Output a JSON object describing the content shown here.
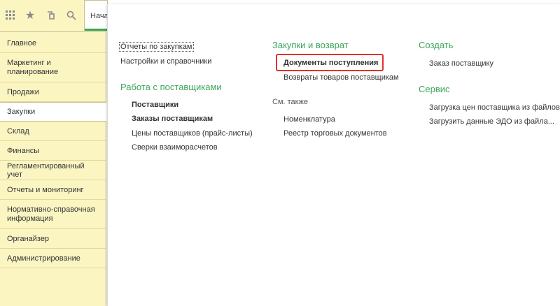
{
  "top_tab": {
    "label": "Нача"
  },
  "sidebar": {
    "items": [
      {
        "label": "Главное"
      },
      {
        "label": "Маркетинг и планирование"
      },
      {
        "label": "Продажи"
      },
      {
        "label": "Закупки"
      },
      {
        "label": "Склад"
      },
      {
        "label": "Финансы"
      },
      {
        "label": "Регламентированный учет"
      },
      {
        "label": "Отчеты и мониторинг"
      },
      {
        "label": "Нормативно-справочная информация"
      },
      {
        "label": "Органайзер"
      },
      {
        "label": "Администрирование"
      }
    ]
  },
  "icons": {
    "apps": "apps-grid-icon",
    "favorites": "star-icon",
    "history": "history-icon",
    "search": "search-icon"
  },
  "col1": {
    "links_top": [
      "Отчеты по закупкам",
      "Настройки и справочники"
    ],
    "section_title": "Работа с поставщиками",
    "links": [
      "Поставщики",
      "Заказы поставщикам",
      "Цены поставщиков (прайс-листы)",
      "Сверки взаиморасчетов"
    ]
  },
  "col2": {
    "section_title": "Закупки и возврат",
    "links": [
      "Документы поступления",
      "Возвраты товаров поставщикам"
    ],
    "see_also_title": "См. также",
    "see_also_links": [
      "Номенклатура",
      "Реестр торговых документов"
    ]
  },
  "col3": {
    "create_title": "Создать",
    "create_links": [
      "Заказ поставщику"
    ],
    "service_title": "Сервис",
    "service_links": [
      "Загрузка цен поставщика из файлов",
      "Загрузить данные ЭДО из файла..."
    ]
  },
  "colors": {
    "accent_green": "#3aa55a",
    "highlight_red": "#e0322b",
    "sidebar_bg": "#fbf5c2"
  }
}
